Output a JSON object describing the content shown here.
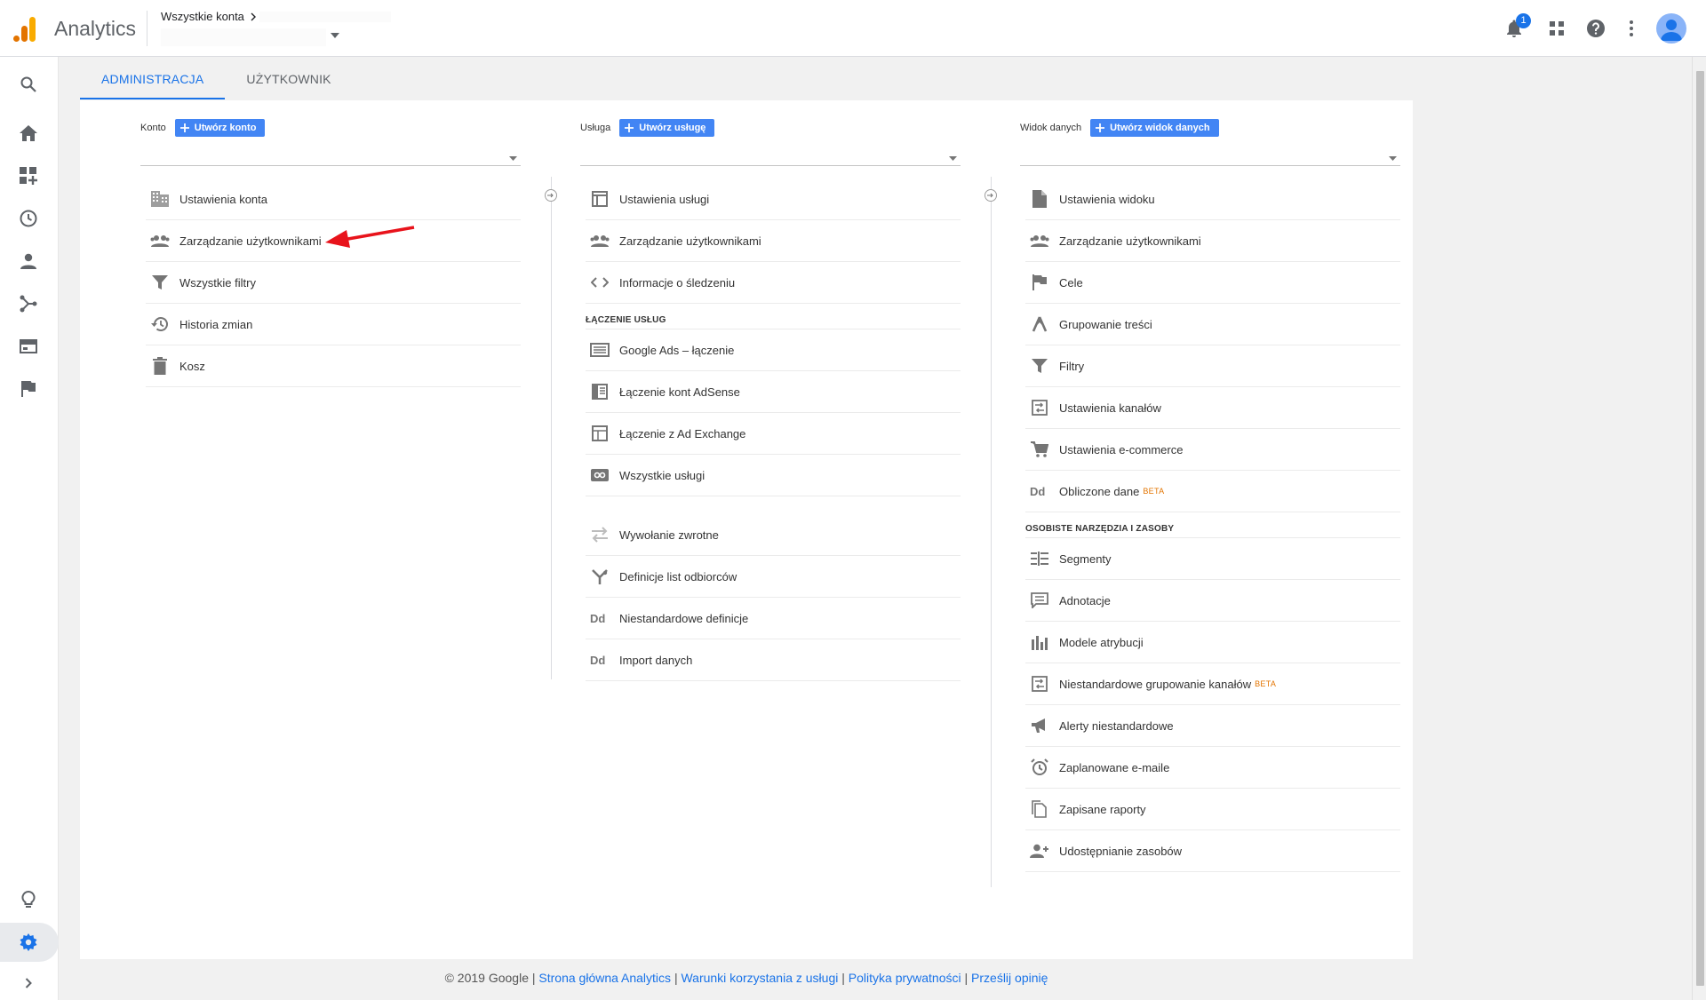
{
  "app": {
    "title": "Analytics"
  },
  "header": {
    "breadcrumb": "Wszystkie konta",
    "notifications_count": "1"
  },
  "tabs": [
    {
      "label": "ADMINISTRACJA",
      "active": true
    },
    {
      "label": "UŻYTKOWNIK",
      "active": false
    }
  ],
  "columns": {
    "account": {
      "label": "Konto",
      "create_label": "Utwórz konto",
      "items": [
        {
          "icon": "building-icon",
          "label": "Ustawienia konta"
        },
        {
          "icon": "people-icon",
          "label": "Zarządzanie użytkownikami"
        },
        {
          "icon": "filter-icon",
          "label": "Wszystkie filtry"
        },
        {
          "icon": "history-icon",
          "label": "Historia zmian"
        },
        {
          "icon": "trash-icon",
          "label": "Kosz"
        }
      ]
    },
    "property": {
      "label": "Usługa",
      "create_label": "Utwórz usługę",
      "items": [
        {
          "icon": "property-settings-icon",
          "label": "Ustawienia usługi"
        },
        {
          "icon": "people-icon",
          "label": "Zarządzanie użytkownikami"
        },
        {
          "icon": "code-icon",
          "label": "Informacje o śledzeniu"
        }
      ],
      "section_title": "ŁĄCZENIE USŁUG",
      "linking_items": [
        {
          "icon": "google-ads-icon",
          "label": "Google Ads – łączenie"
        },
        {
          "icon": "adsense-icon",
          "label": "Łączenie kont AdSense"
        },
        {
          "icon": "ad-exchange-icon",
          "label": "Łączenie z Ad Exchange"
        },
        {
          "icon": "link-icon",
          "label": "Wszystkie usługi"
        }
      ],
      "other_items": [
        {
          "icon": "postbacks-icon",
          "label": "Wywołanie zwrotne"
        },
        {
          "icon": "audience-icon",
          "label": "Definicje list odbiorców"
        },
        {
          "icon": "dd-icon",
          "label": "Niestandardowe definicje"
        },
        {
          "icon": "dd-icon",
          "label": "Import danych"
        }
      ]
    },
    "view": {
      "label": "Widok danych",
      "create_label": "Utwórz widok danych",
      "items": [
        {
          "icon": "document-icon",
          "label": "Ustawienia widoku"
        },
        {
          "icon": "people-icon",
          "label": "Zarządzanie użytkownikami"
        },
        {
          "icon": "flag-icon",
          "label": "Cele"
        },
        {
          "icon": "content-grouping-icon",
          "label": "Grupowanie treści"
        },
        {
          "icon": "filter-icon",
          "label": "Filtry"
        },
        {
          "icon": "channel-settings-icon",
          "label": "Ustawienia kanałów"
        },
        {
          "icon": "cart-icon",
          "label": "Ustawienia e-commerce"
        },
        {
          "icon": "dd-icon",
          "label": "Obliczone dane",
          "badge": "BETA"
        }
      ],
      "section_title": "OSOBISTE NARZĘDZIA I ZASOBY",
      "personal_items": [
        {
          "icon": "segments-icon",
          "label": "Segmenty"
        },
        {
          "icon": "annotation-icon",
          "label": "Adnotacje"
        },
        {
          "icon": "bar-chart-icon",
          "label": "Modele atrybucji"
        },
        {
          "icon": "channel-grouping-icon",
          "label": "Niestandardowe grupowanie kanałów",
          "badge": "BETA"
        },
        {
          "icon": "megaphone-icon",
          "label": "Alerty niestandardowe"
        },
        {
          "icon": "alarm-icon",
          "label": "Zaplanowane e-maile"
        },
        {
          "icon": "copy-icon",
          "label": "Zapisane raporty"
        },
        {
          "icon": "person-add-icon",
          "label": "Udostępnianie zasobów"
        }
      ]
    }
  },
  "footer": {
    "copyright": "© 2019 Google",
    "sep": "|",
    "links": [
      "Strona główna Analytics",
      "Warunki korzystania z usługi",
      "Polityka prywatności",
      "Prześlij opinię"
    ]
  },
  "colors": {
    "accent": "#1a73e8",
    "button": "#4285f4",
    "beta": "#e37400",
    "annotation_arrow": "#e8131b"
  }
}
